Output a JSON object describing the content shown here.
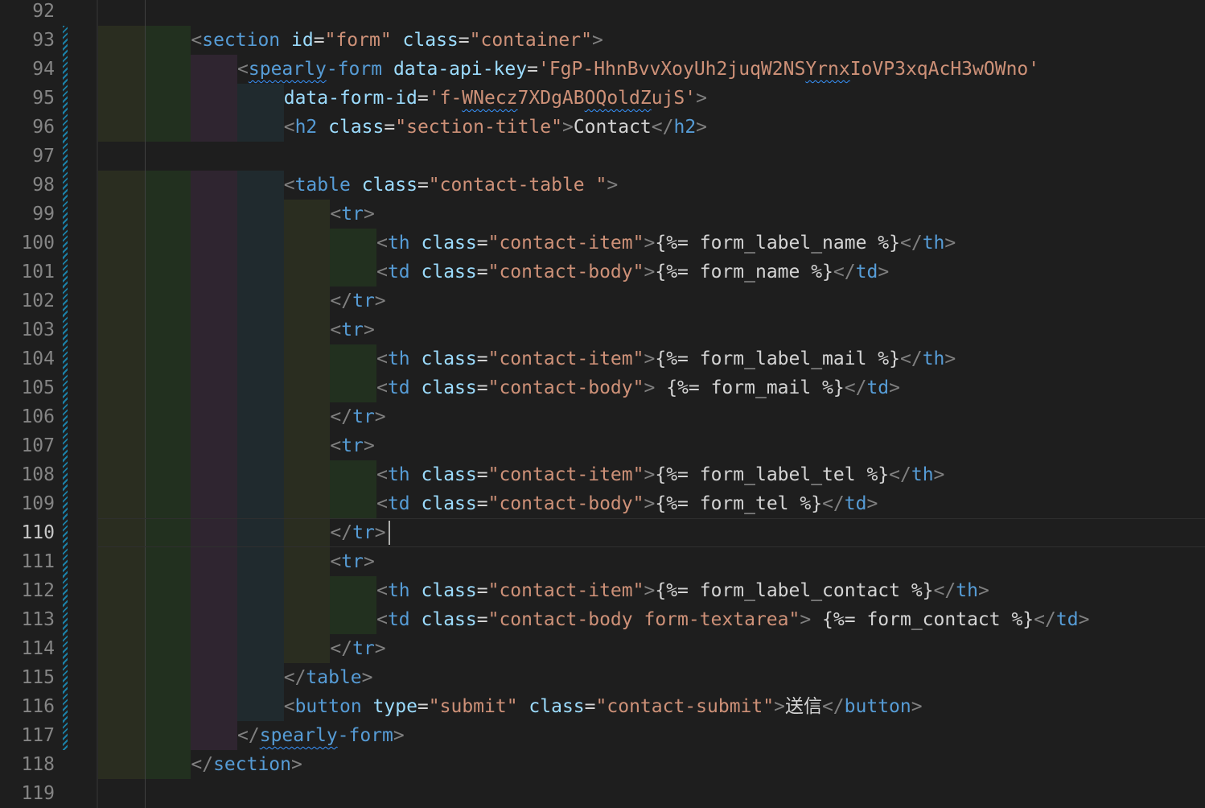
{
  "editor": {
    "active_line": 110,
    "colors": {
      "background": "#1e1e1e",
      "line_number": "#858585",
      "tag": "#569cd6",
      "attribute": "#9cdcfe",
      "string": "#ce9178",
      "punctuation": "#808080",
      "text": "#d4d4d4",
      "modified_marker": "#1b81a8",
      "indent_rainbow": [
        "#2a2d20",
        "#22301f",
        "#2f2530",
        "#202a2e"
      ]
    },
    "lines": [
      {
        "n": "92",
        "indent": 0,
        "tokens": []
      },
      {
        "n": "93",
        "indent": 2,
        "tokens": [
          [
            "p",
            "<"
          ],
          [
            "g",
            "section"
          ],
          [
            "t",
            " "
          ],
          [
            "a",
            "id"
          ],
          [
            "t",
            "="
          ],
          [
            "s",
            "\"form\""
          ],
          [
            "t",
            " "
          ],
          [
            "a",
            "class"
          ],
          [
            "t",
            "="
          ],
          [
            "s",
            "\"container\""
          ],
          [
            "p",
            ">"
          ]
        ]
      },
      {
        "n": "94",
        "indent": 3,
        "tokens": [
          [
            "p",
            "<"
          ],
          [
            "gu",
            "spearly"
          ],
          [
            "g",
            "-form"
          ],
          [
            "t",
            " "
          ],
          [
            "a",
            "data-api-key"
          ],
          [
            "t",
            "="
          ],
          [
            "s",
            "'FgP-HhnBvvXoyUh2juqW2NS"
          ],
          [
            "su",
            "Yrnx"
          ],
          [
            "s",
            "IoVP3xqAcH3wOWno'"
          ]
        ]
      },
      {
        "n": "95",
        "indent": 4,
        "tokens": [
          [
            "a",
            "data-form-id"
          ],
          [
            "t",
            "="
          ],
          [
            "s",
            "'f-"
          ],
          [
            "su",
            "WNecz"
          ],
          [
            "s",
            "7XDgAB"
          ],
          [
            "su",
            "OQoldZ"
          ],
          [
            "s",
            "ujS'"
          ],
          [
            "p",
            ">"
          ]
        ]
      },
      {
        "n": "96",
        "indent": 4,
        "tokens": [
          [
            "p",
            "<"
          ],
          [
            "g",
            "h2"
          ],
          [
            "t",
            " "
          ],
          [
            "a",
            "class"
          ],
          [
            "t",
            "="
          ],
          [
            "s",
            "\"section-title\""
          ],
          [
            "p",
            ">"
          ],
          [
            "t",
            "Contact"
          ],
          [
            "p",
            "</"
          ],
          [
            "g",
            "h2"
          ],
          [
            "p",
            ">"
          ]
        ]
      },
      {
        "n": "97",
        "indent": 0,
        "tokens": []
      },
      {
        "n": "98",
        "indent": 4,
        "tokens": [
          [
            "p",
            "<"
          ],
          [
            "g",
            "table"
          ],
          [
            "t",
            " "
          ],
          [
            "a",
            "class"
          ],
          [
            "t",
            "="
          ],
          [
            "s",
            "\"contact-table \""
          ],
          [
            "p",
            ">"
          ]
        ]
      },
      {
        "n": "99",
        "indent": 5,
        "tokens": [
          [
            "p",
            "<"
          ],
          [
            "g",
            "tr"
          ],
          [
            "p",
            ">"
          ]
        ]
      },
      {
        "n": "100",
        "indent": 6,
        "tokens": [
          [
            "p",
            "<"
          ],
          [
            "g",
            "th"
          ],
          [
            "t",
            " "
          ],
          [
            "a",
            "class"
          ],
          [
            "t",
            "="
          ],
          [
            "s",
            "\"contact-item\""
          ],
          [
            "p",
            ">"
          ],
          [
            "t",
            "{%= form_label_name %}"
          ],
          [
            "p",
            "</"
          ],
          [
            "g",
            "th"
          ],
          [
            "p",
            ">"
          ]
        ]
      },
      {
        "n": "101",
        "indent": 6,
        "tokens": [
          [
            "p",
            "<"
          ],
          [
            "g",
            "td"
          ],
          [
            "t",
            " "
          ],
          [
            "a",
            "class"
          ],
          [
            "t",
            "="
          ],
          [
            "s",
            "\"contact-body\""
          ],
          [
            "p",
            ">"
          ],
          [
            "t",
            "{%= form_name %}"
          ],
          [
            "p",
            "</"
          ],
          [
            "g",
            "td"
          ],
          [
            "p",
            ">"
          ]
        ]
      },
      {
        "n": "102",
        "indent": 5,
        "tokens": [
          [
            "p",
            "</"
          ],
          [
            "g",
            "tr"
          ],
          [
            "p",
            ">"
          ]
        ]
      },
      {
        "n": "103",
        "indent": 5,
        "tokens": [
          [
            "p",
            "<"
          ],
          [
            "g",
            "tr"
          ],
          [
            "p",
            ">"
          ]
        ]
      },
      {
        "n": "104",
        "indent": 6,
        "tokens": [
          [
            "p",
            "<"
          ],
          [
            "g",
            "th"
          ],
          [
            "t",
            " "
          ],
          [
            "a",
            "class"
          ],
          [
            "t",
            "="
          ],
          [
            "s",
            "\"contact-item\""
          ],
          [
            "p",
            ">"
          ],
          [
            "t",
            "{%= form_label_mail %}"
          ],
          [
            "p",
            "</"
          ],
          [
            "g",
            "th"
          ],
          [
            "p",
            ">"
          ]
        ]
      },
      {
        "n": "105",
        "indent": 6,
        "tokens": [
          [
            "p",
            "<"
          ],
          [
            "g",
            "td"
          ],
          [
            "t",
            " "
          ],
          [
            "a",
            "class"
          ],
          [
            "t",
            "="
          ],
          [
            "s",
            "\"contact-body\""
          ],
          [
            "p",
            ">"
          ],
          [
            "t",
            " {%= form_mail %}"
          ],
          [
            "p",
            "</"
          ],
          [
            "g",
            "td"
          ],
          [
            "p",
            ">"
          ]
        ]
      },
      {
        "n": "106",
        "indent": 5,
        "tokens": [
          [
            "p",
            "</"
          ],
          [
            "g",
            "tr"
          ],
          [
            "p",
            ">"
          ]
        ]
      },
      {
        "n": "107",
        "indent": 5,
        "tokens": [
          [
            "p",
            "<"
          ],
          [
            "g",
            "tr"
          ],
          [
            "p",
            ">"
          ]
        ]
      },
      {
        "n": "108",
        "indent": 6,
        "tokens": [
          [
            "p",
            "<"
          ],
          [
            "g",
            "th"
          ],
          [
            "t",
            " "
          ],
          [
            "a",
            "class"
          ],
          [
            "t",
            "="
          ],
          [
            "s",
            "\"contact-item\""
          ],
          [
            "p",
            ">"
          ],
          [
            "t",
            "{%= form_label_tel %}"
          ],
          [
            "p",
            "</"
          ],
          [
            "g",
            "th"
          ],
          [
            "p",
            ">"
          ]
        ]
      },
      {
        "n": "109",
        "indent": 6,
        "tokens": [
          [
            "p",
            "<"
          ],
          [
            "g",
            "td"
          ],
          [
            "t",
            " "
          ],
          [
            "a",
            "class"
          ],
          [
            "t",
            "="
          ],
          [
            "s",
            "\"contact-body\""
          ],
          [
            "p",
            ">"
          ],
          [
            "t",
            "{%= form_tel %}"
          ],
          [
            "p",
            "</"
          ],
          [
            "g",
            "td"
          ],
          [
            "p",
            ">"
          ]
        ]
      },
      {
        "n": "110",
        "indent": 5,
        "tokens": [
          [
            "p",
            "</"
          ],
          [
            "g",
            "tr"
          ],
          [
            "p",
            ">"
          ]
        ]
      },
      {
        "n": "111",
        "indent": 5,
        "tokens": [
          [
            "p",
            "<"
          ],
          [
            "g",
            "tr"
          ],
          [
            "p",
            ">"
          ]
        ]
      },
      {
        "n": "112",
        "indent": 6,
        "tokens": [
          [
            "p",
            "<"
          ],
          [
            "g",
            "th"
          ],
          [
            "t",
            " "
          ],
          [
            "a",
            "class"
          ],
          [
            "t",
            "="
          ],
          [
            "s",
            "\"contact-item\""
          ],
          [
            "p",
            ">"
          ],
          [
            "t",
            "{%= form_label_contact %}"
          ],
          [
            "p",
            "</"
          ],
          [
            "g",
            "th"
          ],
          [
            "p",
            ">"
          ]
        ]
      },
      {
        "n": "113",
        "indent": 6,
        "tokens": [
          [
            "p",
            "<"
          ],
          [
            "g",
            "td"
          ],
          [
            "t",
            " "
          ],
          [
            "a",
            "class"
          ],
          [
            "t",
            "="
          ],
          [
            "s",
            "\"contact-body form-textarea\""
          ],
          [
            "p",
            ">"
          ],
          [
            "t",
            " {%= form_contact %}"
          ],
          [
            "p",
            "</"
          ],
          [
            "g",
            "td"
          ],
          [
            "p",
            ">"
          ]
        ]
      },
      {
        "n": "114",
        "indent": 5,
        "tokens": [
          [
            "p",
            "</"
          ],
          [
            "g",
            "tr"
          ],
          [
            "p",
            ">"
          ]
        ]
      },
      {
        "n": "115",
        "indent": 4,
        "tokens": [
          [
            "p",
            "</"
          ],
          [
            "g",
            "table"
          ],
          [
            "p",
            ">"
          ]
        ]
      },
      {
        "n": "116",
        "indent": 4,
        "tokens": [
          [
            "p",
            "<"
          ],
          [
            "g",
            "button"
          ],
          [
            "t",
            " "
          ],
          [
            "a",
            "type"
          ],
          [
            "t",
            "="
          ],
          [
            "s",
            "\"submit\""
          ],
          [
            "t",
            " "
          ],
          [
            "a",
            "class"
          ],
          [
            "t",
            "="
          ],
          [
            "s",
            "\"contact-submit\""
          ],
          [
            "p",
            ">"
          ],
          [
            "t",
            "送信"
          ],
          [
            "p",
            "</"
          ],
          [
            "g",
            "button"
          ],
          [
            "p",
            ">"
          ]
        ]
      },
      {
        "n": "117",
        "indent": 3,
        "tokens": [
          [
            "p",
            "</"
          ],
          [
            "gu",
            "spearly"
          ],
          [
            "g",
            "-form"
          ],
          [
            "p",
            ">"
          ]
        ]
      },
      {
        "n": "118",
        "indent": 2,
        "tokens": [
          [
            "p",
            "</"
          ],
          [
            "g",
            "section"
          ],
          [
            "p",
            ">"
          ]
        ]
      },
      {
        "n": "119",
        "indent": 0,
        "tokens": []
      }
    ]
  }
}
